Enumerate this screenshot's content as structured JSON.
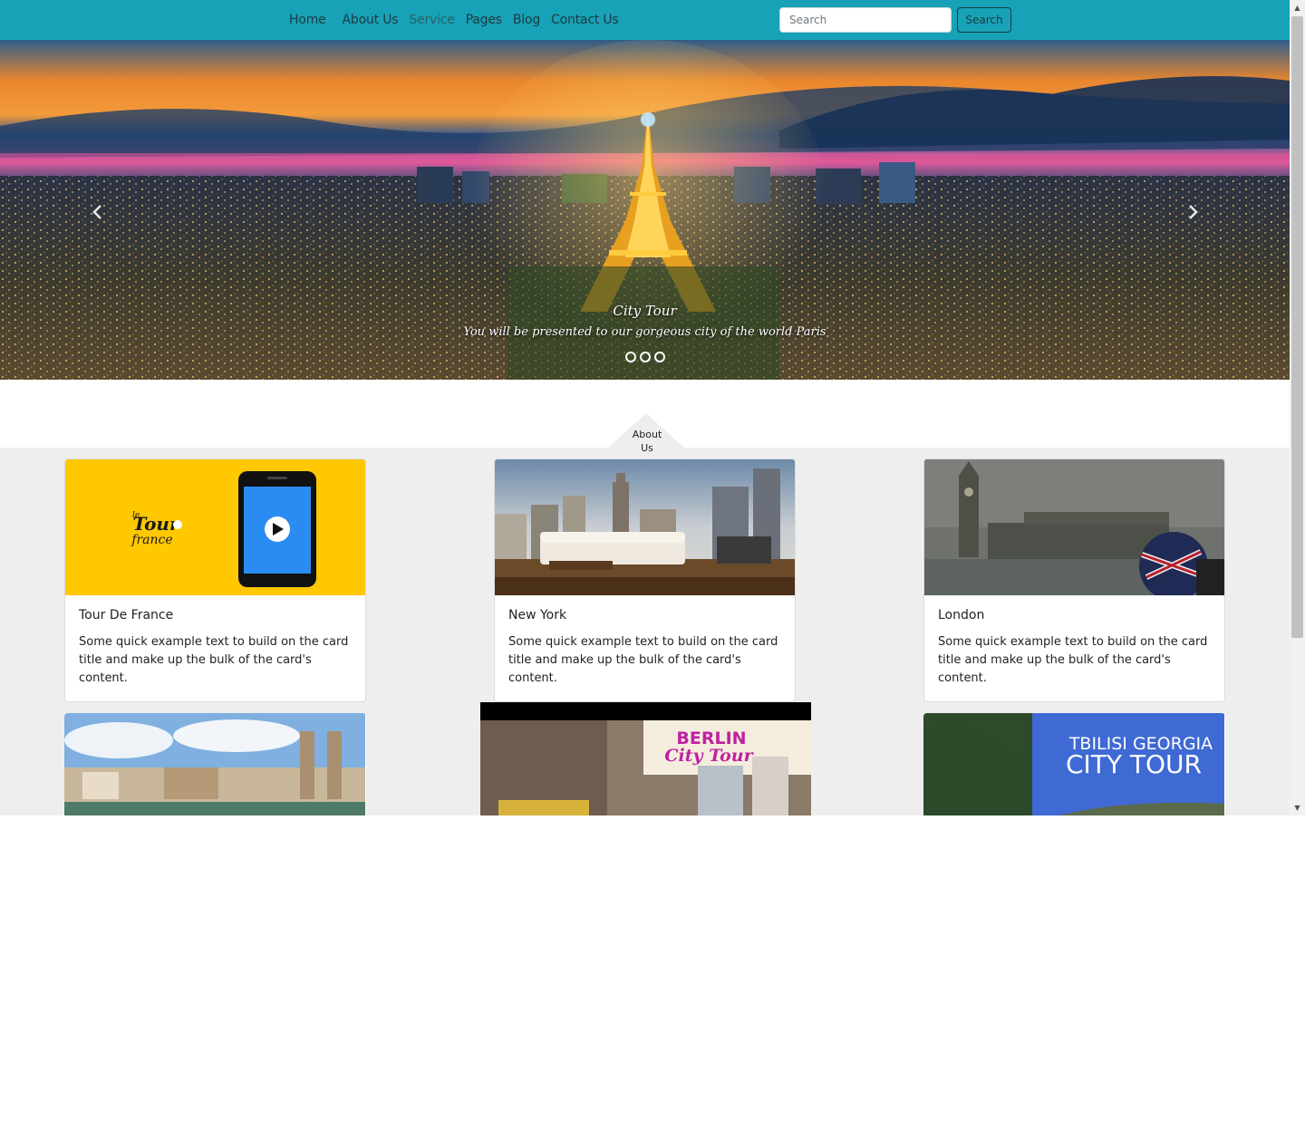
{
  "navbar": {
    "links": [
      {
        "label": "Home"
      },
      {
        "label": "About Us"
      },
      {
        "label": "Service"
      },
      {
        "label": "Pages"
      },
      {
        "label": "Blog"
      },
      {
        "label": "Contact Us"
      }
    ],
    "search": {
      "placeholder": "Search",
      "value": ""
    },
    "search_button_label": "Search",
    "background_color": "#17a2b8"
  },
  "hero": {
    "caption_title": "City Tour",
    "caption_text": "You will be presented to our gorgeous city of the world Paris",
    "slide_count": 3,
    "prev_icon": "chevron-left-icon",
    "next_icon": "chevron-right-icon"
  },
  "about_tab": {
    "label_line1": "About",
    "label_line2": "Us"
  },
  "cards": [
    {
      "title": "Tour De France",
      "text": "Some quick example text to build on the card title and make up the bulk of the card's content.",
      "image": "tour-de-france-phone-image"
    },
    {
      "title": "New York",
      "text": "Some quick example text to build on the card title and make up the bulk of the card's content.",
      "image": "new-york-skyline-living-room-image"
    },
    {
      "title": "London",
      "text": "Some quick example text to build on the card title and make up the bulk of the card's content.",
      "image": "london-big-ben-rain-image"
    }
  ],
  "bottom_cards": [
    {
      "image": "zurich-river-image"
    },
    {
      "image": "berlin-city-tour-image",
      "overlay_line1": "BERLIN",
      "overlay_line2": "City Tour"
    },
    {
      "image": "tbilisi-georgia-image",
      "overlay_line1": "TBILISI GEORGIA",
      "overlay_line2": "CITY TOUR"
    }
  ]
}
